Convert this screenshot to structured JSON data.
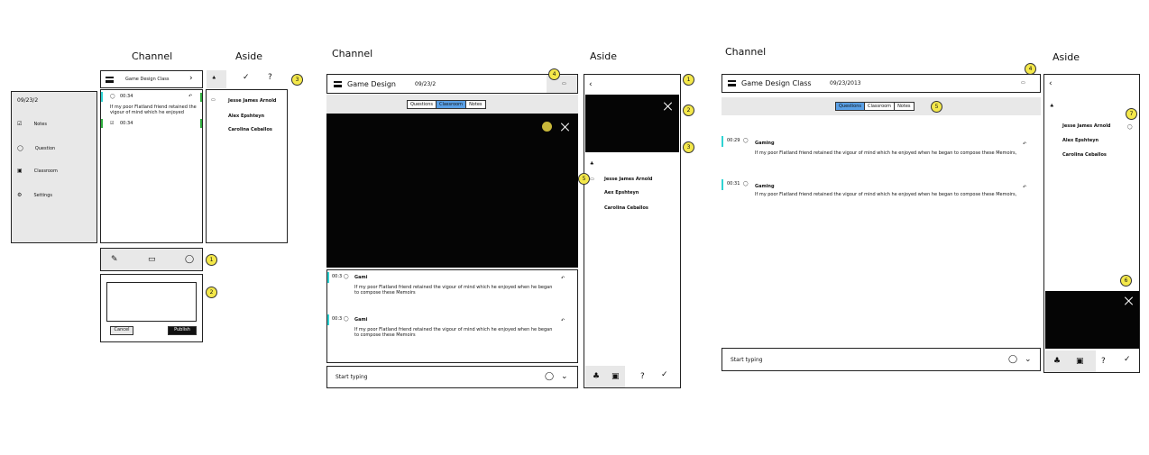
{
  "headings": {
    "channel1": "Channel",
    "aside1": "Aside",
    "channel2": "Channel",
    "aside2": "Aside",
    "channel3": "Channel",
    "aside3": "Aside"
  },
  "mock1": {
    "sidebar": {
      "date": "09/23/2",
      "items": [
        {
          "label": "Notes",
          "icon": "notes-icon"
        },
        {
          "label": "Question",
          "icon": "speech-bubble-icon"
        },
        {
          "label": "Classroom",
          "icon": "image-icon"
        },
        {
          "label": "Settings",
          "icon": "gear-icon"
        }
      ]
    },
    "channel": {
      "title": "Game Design Class",
      "messages": [
        {
          "time": "00:34",
          "text": "If my poor Flatland friend retained the vigour of mind which he enjoyed"
        },
        {
          "time": "00:34",
          "text": ""
        }
      ]
    },
    "aside": {
      "names": [
        "Jesse James Arnold",
        "Alex Epshteyn",
        "Carolina Ceballos"
      ]
    },
    "composer": {
      "cancel": "Cancel",
      "publish": "Publish"
    },
    "markers": [
      "1",
      "2",
      "3"
    ]
  },
  "mock2": {
    "title": "Game Design",
    "date": "09/23/2",
    "tabs": [
      "Questions",
      "Classroom",
      "Notes"
    ],
    "active_tab": "Classroom",
    "messages": [
      {
        "time": "00:3",
        "author": "Gami",
        "text": "If my poor Flatland friend retained the vigour of mind which he enjoyed when he began to compose these Memoirs"
      },
      {
        "time": "00:3",
        "author": "Gami",
        "text": "If my poor Flatland friend retained the vigour of mind which he enjoyed when he began to compose these Memoirs"
      }
    ],
    "input_placeholder": "Start typing",
    "aside": {
      "names": [
        "Jesse James Arnold",
        "Aex Epshteyn",
        "Carolina Ceballos"
      ]
    },
    "markers": [
      "4",
      "1",
      "2",
      "3",
      "5"
    ]
  },
  "mock3": {
    "title": "Game Design Class",
    "date": "09/23/2013",
    "tabs": [
      "Questions",
      "Classroom",
      "Notes"
    ],
    "active_tab": "Questions",
    "messages": [
      {
        "time": "00:29",
        "author": "Gaming",
        "text": "If my poor Flatland friend retained the vigour of mind which he enjoyed when he began to compose these Memoirs,"
      },
      {
        "time": "00:31",
        "author": "Gaming",
        "text": "If my poor Flatland friend retained the vigour of mind which he enjoyed when he began to compose these Memoirs,"
      }
    ],
    "input_placeholder": "Start typing",
    "aside": {
      "names": [
        "Jesse James Arnold",
        "Alex Epshteyn",
        "Carolina Ceballos"
      ]
    },
    "markers": [
      "4",
      "5",
      "7",
      "6"
    ]
  }
}
